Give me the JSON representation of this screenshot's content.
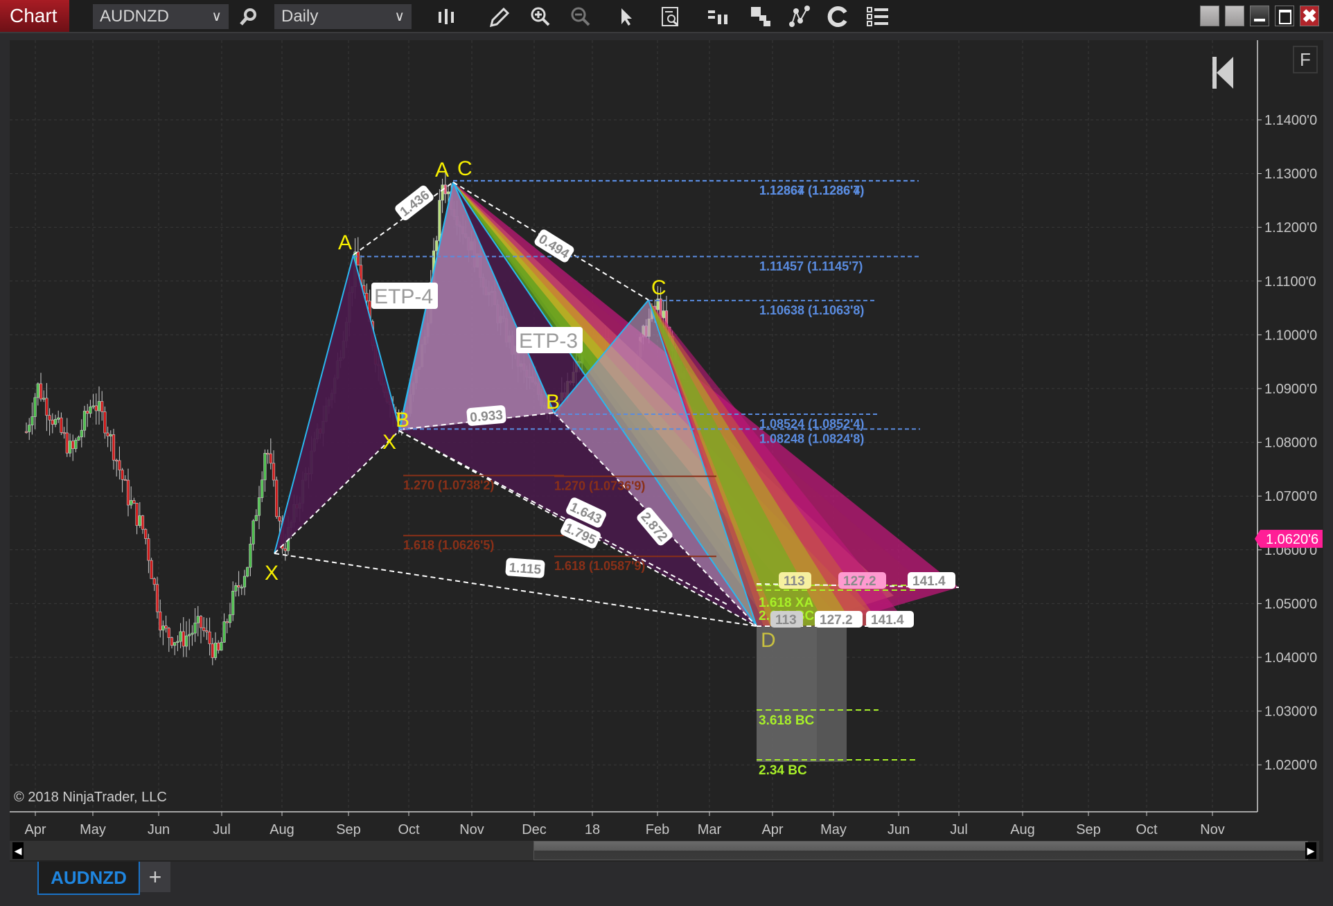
{
  "toolbar": {
    "title": "Chart",
    "instrument": "AUDNZD",
    "interval": "Daily",
    "icons": [
      "bars-type-icon",
      "draw-pencil-icon",
      "zoom-in-icon",
      "zoom-out-icon",
      "pointer-icon",
      "data-box-icon",
      "strategies-icon",
      "templates-icon",
      "indicators-icon",
      "refresh-icon",
      "properties-list-icon"
    ]
  },
  "window_controls": [
    "tile-1",
    "tile-2",
    "minimize",
    "maximize",
    "close"
  ],
  "chart": {
    "flag_label": "F",
    "copyright": "© 2018 NinjaTrader, LLC",
    "current_price": "1.0620'6",
    "current_price_color": "#ff1e96"
  },
  "chart_data": {
    "type": "candlestick",
    "instrument": "AUDNZD",
    "interval": "Daily",
    "ylim": [
      1.013,
      1.153
    ],
    "y_ticks": [
      "1.1400'0",
      "1.1300'0",
      "1.1200'0",
      "1.1100'0",
      "1.1000'0",
      "1.0900'0",
      "1.0800'0",
      "1.0700'0",
      "1.0600'0",
      "1.0500'0",
      "1.0400'0",
      "1.0300'0",
      "1.0200'0"
    ],
    "y_tick_values": [
      1.14,
      1.13,
      1.12,
      1.11,
      1.1,
      1.09,
      1.08,
      1.07,
      1.06,
      1.05,
      1.04,
      1.03,
      1.02
    ],
    "x_ticks": [
      "Apr",
      "May",
      "Jun",
      "Jul",
      "Aug",
      "Sep",
      "Oct",
      "Nov",
      "Dec",
      "18",
      "Feb",
      "Mar",
      "Apr",
      "May",
      "Jun",
      "Jul",
      "Aug",
      "Sep",
      "Oct",
      "Nov"
    ],
    "patterns": [
      {
        "name": "ETP-4",
        "points": [
          {
            "label": "X",
            "price": 1.059
          },
          {
            "label": "A",
            "price": 1.1146
          },
          {
            "label": "B",
            "price": 1.083
          },
          {
            "label": "C",
            "price": 1.1287
          },
          {
            "label": "D",
            "price": 1.046
          }
        ]
      },
      {
        "name": "ETP-3",
        "points": [
          {
            "label": "X",
            "price": 1.0825
          },
          {
            "label": "A",
            "price": 1.1287
          },
          {
            "label": "B",
            "price": 1.0852
          },
          {
            "label": "C",
            "price": 1.1064
          },
          {
            "label": "D",
            "price": 1.046
          }
        ]
      }
    ],
    "ratio_labels": [
      "1.436",
      "0.494",
      "0.933",
      "1.643",
      "1.795",
      "2.872",
      "1.115"
    ],
    "fib_levels_blue": [
      {
        "label": "1.12864 (1.1286'4)",
        "value": 1.12864
      },
      {
        "label": "1.12867 (1.1286'7)",
        "value": 1.12867
      },
      {
        "label": "1.11457 (1.1145'7)",
        "value": 1.11457
      },
      {
        "label": "1.10638 (1.1063'8)",
        "value": 1.10638
      },
      {
        "label": "1.08524 (1.0852'4)",
        "value": 1.08524
      },
      {
        "label": "1.08248 (1.0824'8)",
        "value": 1.08248
      }
    ],
    "fib_levels_brown": [
      {
        "label": "1.270 (1.0738'2)",
        "value": 1.07382
      },
      {
        "label": "1.270 (1.0736'9)",
        "value": 1.07369
      },
      {
        "label": "1.618 (1.0626'5)",
        "value": 1.06265
      },
      {
        "label": "1.618 (1.0587'9)",
        "value": 1.05879
      }
    ],
    "target_levels_green": [
      {
        "label": "1.618 XA",
        "value": 1.0522
      },
      {
        "label": "2.618 BC",
        "value": 1.0513
      },
      {
        "label": "3.618 BC",
        "value": 1.0297
      },
      {
        "label": "2.34 BC",
        "value": 1.0205
      }
    ],
    "extension_tags_upper": [
      "113",
      "127.2",
      "141.4"
    ],
    "extension_tags_lower": [
      "113",
      "127.2",
      "141.4"
    ],
    "current_price": 1.06206
  },
  "scrollbar": {
    "left_arrow": "◀",
    "right_arrow": "▶"
  },
  "tabs": [
    {
      "label": "AUDNZD",
      "active": true
    }
  ],
  "tab_add_label": "+"
}
